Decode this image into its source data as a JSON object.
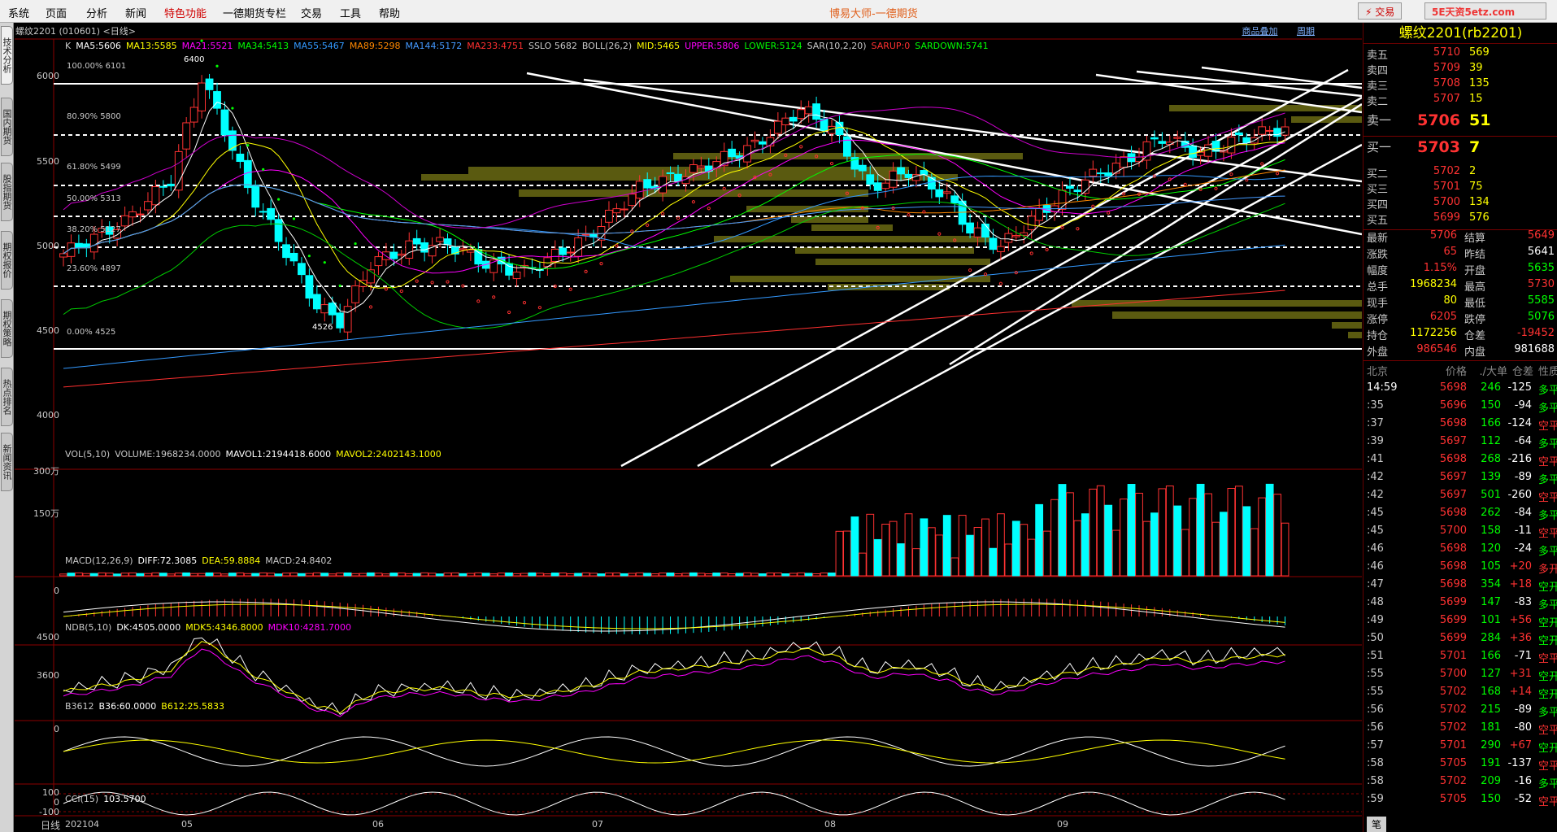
{
  "menu": [
    "系统",
    "页面",
    "分析",
    "新闻",
    "特色功能",
    "一德期货专栏",
    "交易",
    "工具",
    "帮助"
  ],
  "app_title": "博易大师-一德期货",
  "trade_btn": "⚡ 交易",
  "sidetabs": [
    "技术分析",
    "国内期货",
    "股指期货",
    "期权报价",
    "期权策略",
    "热点排名",
    "新闻资讯"
  ],
  "chart": {
    "title": "螺纹2201 (010601) <日线>",
    "links": [
      "商品叠加",
      "周期"
    ],
    "main_ind": [
      {
        "t": "K",
        "c": "#c8c8c8"
      },
      {
        "t": "MA5:5606",
        "c": "#ffffff"
      },
      {
        "t": "MA13:5585",
        "c": "#ffff00"
      },
      {
        "t": "MA21:5521",
        "c": "#ff00ff"
      },
      {
        "t": "MA34:5413",
        "c": "#00ff00"
      },
      {
        "t": "MA55:5467",
        "c": "#3399ff"
      },
      {
        "t": "MA89:5298",
        "c": "#ff8800"
      },
      {
        "t": "MA144:5172",
        "c": "#4499ff"
      },
      {
        "t": "MA233:4751",
        "c": "#ff3030"
      },
      {
        "t": "SSLO 5682",
        "c": "#c8c8c8"
      },
      {
        "t": "BOLL(26,2)",
        "c": "#c8c8c8"
      },
      {
        "t": "MID:5465",
        "c": "#ffff00"
      },
      {
        "t": "UPPER:5806",
        "c": "#ff00ff"
      },
      {
        "t": "LOWER:5124",
        "c": "#00ff00"
      },
      {
        "t": "SAR(10,2,20)",
        "c": "#c8c8c8"
      },
      {
        "t": "SARUP:0",
        "c": "#ff3030"
      },
      {
        "t": "SARDOWN:5741",
        "c": "#00ff00"
      }
    ],
    "yaxis": [
      "6000",
      "5500",
      "5000",
      "4500",
      "4000"
    ],
    "fib": [
      "100.00% 6101",
      "80.90% 5800",
      "61.80% 5499",
      "50.00% 5313",
      "38.20% 5127",
      "23.60% 4897",
      "0.00% 4525"
    ],
    "hi_lbl": "6400",
    "lo_lbl": "4526",
    "vol_ind": [
      {
        "t": "VOL(5,10)",
        "c": "#c8c8c8"
      },
      {
        "t": "VOLUME:1968234.0000",
        "c": "#c8c8c8"
      },
      {
        "t": "MAVOL1:2194418.6000",
        "c": "#ffffff"
      },
      {
        "t": "MAVOL2:2402143.1000",
        "c": "#ffff00"
      }
    ],
    "vol_y": [
      "300万",
      "150万"
    ],
    "macd_ind": [
      {
        "t": "MACD(12,26,9)",
        "c": "#c8c8c8"
      },
      {
        "t": "DIFF:72.3085",
        "c": "#ffffff"
      },
      {
        "t": "DEA:59.8884",
        "c": "#ffff00"
      },
      {
        "t": "MACD:24.8402",
        "c": "#c8c8c8"
      }
    ],
    "macd_y": [
      "0"
    ],
    "ndb_ind": [
      {
        "t": "NDB(5,10)",
        "c": "#c8c8c8"
      },
      {
        "t": "DK:4505.0000",
        "c": "#ffffff"
      },
      {
        "t": "MDK5:4346.8000",
        "c": "#ffff00"
      },
      {
        "t": "MDK10:4281.7000",
        "c": "#ff00ff"
      }
    ],
    "ndb_y": [
      "4500",
      "3600"
    ],
    "b_ind": [
      {
        "t": "B3612",
        "c": "#c8c8c8"
      },
      {
        "t": "B36:60.0000",
        "c": "#ffffff"
      },
      {
        "t": "B612:25.5833",
        "c": "#ffff00"
      }
    ],
    "b_y": [
      "0"
    ],
    "cci_ind": [
      {
        "t": "CCI(15)",
        "c": "#c8c8c8"
      },
      {
        "t": "103.5700",
        "c": "#ffffff"
      }
    ],
    "cci_y": [
      "100",
      "0",
      "-100"
    ],
    "xaxis": [
      "日线",
      "202104",
      "05",
      "06",
      "07",
      "08",
      "09"
    ]
  },
  "panel": {
    "title": "螺纹2201(rb2201)",
    "asks": [
      {
        "l": "卖五",
        "p": "5710",
        "v": "569"
      },
      {
        "l": "卖四",
        "p": "5709",
        "v": "39"
      },
      {
        "l": "卖三",
        "p": "5708",
        "v": "135"
      },
      {
        "l": "卖二",
        "p": "5707",
        "v": "15"
      },
      {
        "l": "卖一",
        "p": "5706",
        "v": "51"
      }
    ],
    "bids": [
      {
        "l": "买一",
        "p": "5703",
        "v": "7"
      },
      {
        "l": "买二",
        "p": "5702",
        "v": "2"
      },
      {
        "l": "买三",
        "p": "5701",
        "v": "75"
      },
      {
        "l": "买四",
        "p": "5700",
        "v": "134"
      },
      {
        "l": "买五",
        "p": "5699",
        "v": "576"
      }
    ],
    "quote": [
      [
        "最新",
        "5706",
        "结算",
        "5649"
      ],
      [
        "涨跌",
        "65",
        "昨结",
        "5641"
      ],
      [
        "幅度",
        "1.15%",
        "开盘",
        "5635"
      ],
      [
        "总手",
        "1968234",
        "最高",
        "5730"
      ],
      [
        "现手",
        "80",
        "最低",
        "5585"
      ],
      [
        "涨停",
        "6205",
        "跌停",
        "5076"
      ],
      [
        "持仓",
        "1172256",
        "仓差",
        "-19452"
      ],
      [
        "外盘",
        "986546",
        "内盘",
        "981688"
      ]
    ],
    "tick_head": [
      "北京",
      "价格",
      "./大单",
      "仓差",
      "性质"
    ],
    "ticks": [
      [
        "14:59",
        "5698",
        "246",
        "-125",
        "多平"
      ],
      [
        ":35",
        "5696",
        "150",
        "-94",
        "多平"
      ],
      [
        ":37",
        "5698",
        "166",
        "-124",
        "空平"
      ],
      [
        ":39",
        "5697",
        "112",
        "-64",
        "多平"
      ],
      [
        ":41",
        "5698",
        "268",
        "-216",
        "空平"
      ],
      [
        ":42",
        "5697",
        "139",
        "-89",
        "多平"
      ],
      [
        ":42",
        "5697",
        "501",
        "-260",
        "空平"
      ],
      [
        ":45",
        "5698",
        "262",
        "-84",
        "多平"
      ],
      [
        ":45",
        "5700",
        "158",
        "-11",
        "空平"
      ],
      [
        ":46",
        "5698",
        "120",
        "-24",
        "多平"
      ],
      [
        ":46",
        "5698",
        "105",
        "+20",
        "多开"
      ],
      [
        ":47",
        "5698",
        "354",
        "+18",
        "空开"
      ],
      [
        ":48",
        "5699",
        "147",
        "-83",
        "多平"
      ],
      [
        ":49",
        "5699",
        "101",
        "+56",
        "空开"
      ],
      [
        ":50",
        "5699",
        "284",
        "+36",
        "空开"
      ],
      [
        ":51",
        "5701",
        "166",
        "-71",
        "空平"
      ],
      [
        ":55",
        "5700",
        "127",
        "+31",
        "空开"
      ],
      [
        ":55",
        "5702",
        "168",
        "+14",
        "空开"
      ],
      [
        ":56",
        "5702",
        "215",
        "-89",
        "多平"
      ],
      [
        ":56",
        "5702",
        "181",
        "-80",
        "空平"
      ],
      [
        ":57",
        "5701",
        "290",
        "+67",
        "空开"
      ],
      [
        ":58",
        "5705",
        "191",
        "-137",
        "空平"
      ],
      [
        ":58",
        "5702",
        "209",
        "-16",
        "多平"
      ],
      [
        ":59",
        "5705",
        "150",
        "-52",
        "空平"
      ]
    ],
    "bottom_tab": "笔",
    "watermark": "5E天资5etz.com"
  },
  "colors": {
    "up": "#ff3232",
    "down": "#00ffff",
    "grid": "#8b0000"
  }
}
